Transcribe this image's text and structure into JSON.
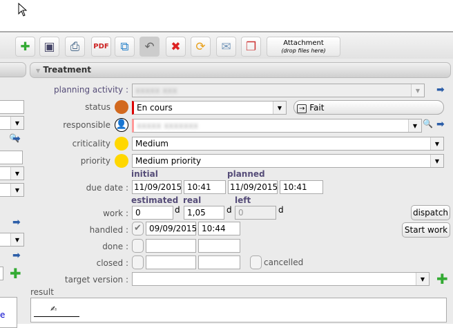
{
  "toolbar": {
    "buttons": [
      "new-icon",
      "save-icon",
      "print-icon",
      "pdf-icon",
      "copy-icon",
      "undo-icon",
      "delete-icon",
      "refresh-icon",
      "email-icon",
      "multi-save-icon"
    ],
    "attachment_label": "Attachment",
    "attachment_hint": "(drop files here)"
  },
  "section": {
    "title": "Treatment"
  },
  "form": {
    "planning_activity_label": "planning activity :",
    "status_label": "status",
    "status_value": "En cours",
    "status_color": "#d2691e",
    "status_next_button": "Fait",
    "responsible_label": "responsible",
    "criticality_label": "criticality",
    "criticality_value": "Medium",
    "criticality_color": "#ffd700",
    "priority_label": "priority",
    "priority_value": "Medium priority",
    "priority_color": "#ffd700",
    "due_date_label": "due date :",
    "initial_label": "initial",
    "planned_label": "planned",
    "initial_date": "11/09/2015",
    "initial_time": "10:41",
    "planned_date": "11/09/2015",
    "planned_time": "10:41",
    "work_label": "work :",
    "estimated_label": "estimated",
    "real_label": "real",
    "left_label": "left",
    "estimated_value": "0",
    "real_value": "1,05",
    "left_value": "0",
    "unit": "d",
    "dispatch_button": "dispatch",
    "start_work_button": "Start work",
    "handled_label": "handled :",
    "handled_date": "09/09/2015",
    "handled_time": "10:44",
    "done_label": "done :",
    "closed_label": "closed :",
    "cancelled_label": "cancelled",
    "target_version_label": "target version :",
    "result_label": "result"
  },
  "left_panel": {
    "partial_text": "e"
  }
}
